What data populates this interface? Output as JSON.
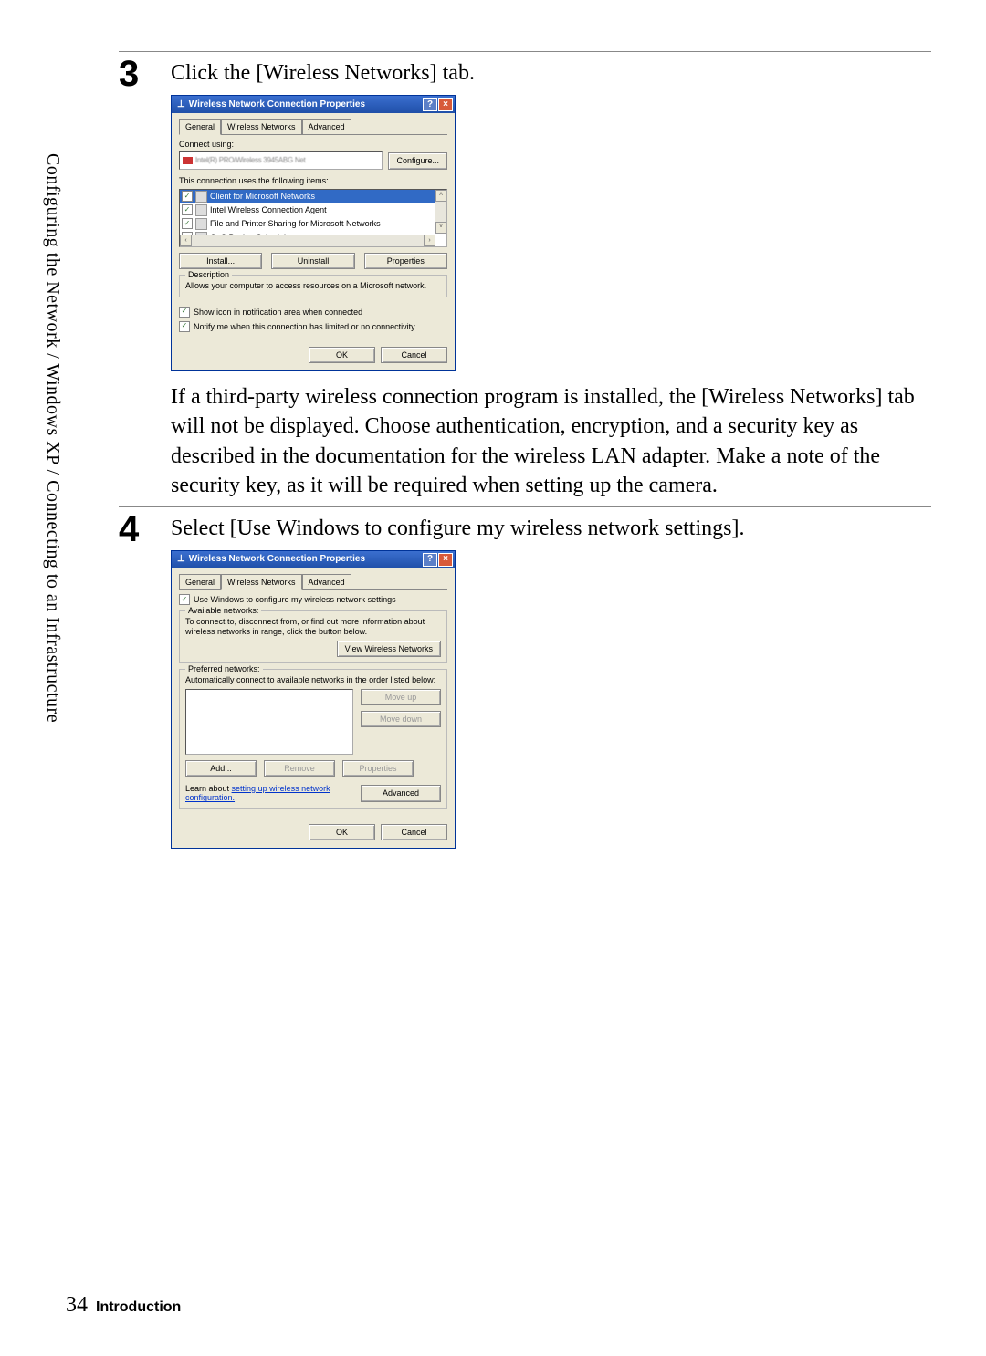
{
  "sidebar": "Configuring the Network / Windows XP / Connecting to an Infrastructure",
  "step3": {
    "num": "3",
    "title": "Click the [Wireless Networks] tab.",
    "body": "If a third-party wireless connection program is installed, the [Wireless Networks] tab will not be displayed.  Choose authentication, encryption, and a security key as described in the documentation for the wireless LAN adapter.  Make a note of the security key, as it will be required when setting up the camera."
  },
  "step4": {
    "num": "4",
    "title": "Select [Use Windows to configure my wireless network settings]."
  },
  "dialog1": {
    "title": "Wireless Network Connection Properties",
    "tabs": {
      "general": "General",
      "wireless": "Wireless Networks",
      "advanced": "Advanced"
    },
    "connect_using": "Connect using:",
    "adapter_placeholder": "Intel(R) PRO/Wireless 3945ABG Net",
    "configure": "Configure...",
    "uses_items": "This connection uses the following items:",
    "items": [
      "Client for Microsoft Networks",
      "Intel Wireless Connection Agent",
      "File and Printer Sharing for Microsoft Networks",
      "QoS Packet Scheduler"
    ],
    "install": "Install...",
    "uninstall": "Uninstall",
    "properties": "Properties",
    "desc_title": "Description",
    "desc_body": "Allows your computer to access resources on a Microsoft network.",
    "show_icon": "Show icon in notification area when connected",
    "notify": "Notify me when this connection has limited or no connectivity",
    "ok": "OK",
    "cancel": "Cancel"
  },
  "dialog2": {
    "title": "Wireless Network Connection Properties",
    "tabs": {
      "general": "General",
      "wireless": "Wireless Networks",
      "advanced": "Advanced"
    },
    "use_windows": "Use Windows to configure my wireless network settings",
    "avail_title": "Available networks:",
    "avail_body": "To connect to, disconnect from, or find out more information about wireless networks in range, click the button below.",
    "view_btn": "View Wireless Networks",
    "pref_title": "Preferred networks:",
    "pref_body": "Automatically connect to available networks in the order listed below:",
    "move_up": "Move up",
    "move_down": "Move down",
    "add": "Add...",
    "remove": "Remove",
    "properties": "Properties",
    "learn": "Learn about ",
    "learn_link": "setting up wireless network configuration.",
    "advanced_btn": "Advanced",
    "ok": "OK",
    "cancel": "Cancel"
  },
  "footer": {
    "page": "34",
    "section": "Introduction"
  }
}
